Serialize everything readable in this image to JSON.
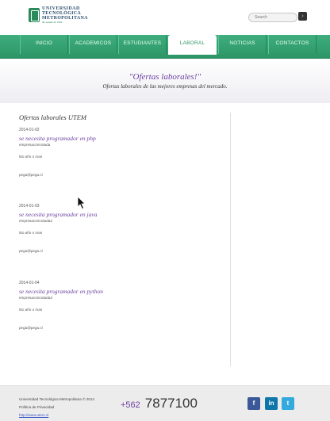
{
  "header": {
    "logo_line1": "UNIVERSIDAD",
    "logo_line2": "TECNOLÓGICA",
    "logo_line3": "METROPOLITANA",
    "logo_tagline": "del estado de Chile",
    "search_placeholder": "Search",
    "search_button_icon": "search-icon"
  },
  "nav": {
    "items": [
      {
        "label": "INICIO"
      },
      {
        "label": "ACADEMICOS"
      },
      {
        "label": "ESTUDIANTES"
      },
      {
        "label": "LABORAL"
      },
      {
        "label": "NOTICIAS"
      },
      {
        "label": "CONTACTOS"
      }
    ],
    "active": "LABORAL"
  },
  "banner": {
    "title": "\"Ofertas laborales!\"",
    "subtitle": "Ofertas laborales de las mejores empresas del mercado."
  },
  "main": {
    "section_title": "Ofertas laborales UTEM",
    "offers": [
      {
        "date": "2014-01-02",
        "title": "se necesita programador en php",
        "company": "empresaconnotada",
        "requirement": "5to año o mas",
        "email": "pega@pega.cl"
      },
      {
        "date": "2014-01-03",
        "title": "se necesita programador en java",
        "company": "empresaconnotada2",
        "requirement": "5to año o mas",
        "email": "pega@pega.cl"
      },
      {
        "date": "2014-01-04",
        "title": "se necesita programador en python",
        "company": "empresaconnotada3",
        "requirement": "5to año o mas",
        "email": "pega@pega.cl"
      }
    ]
  },
  "footer": {
    "copyright": "Universidad Tecnológica Metropolitana © 2014",
    "privacy": "Política de Privacidad",
    "url": "http://www.utem.cl",
    "phone_code": "+562",
    "phone_number": "7877100",
    "social": [
      {
        "icon": "facebook-icon",
        "glyph": "f"
      },
      {
        "icon": "linkedin-icon",
        "glyph": "in"
      },
      {
        "icon": "twitter-icon",
        "glyph": "t"
      }
    ]
  },
  "colors": {
    "nav_green": "#2c9566",
    "accent_purple": "#6b3fa0",
    "footer_bg": "#ececec"
  }
}
